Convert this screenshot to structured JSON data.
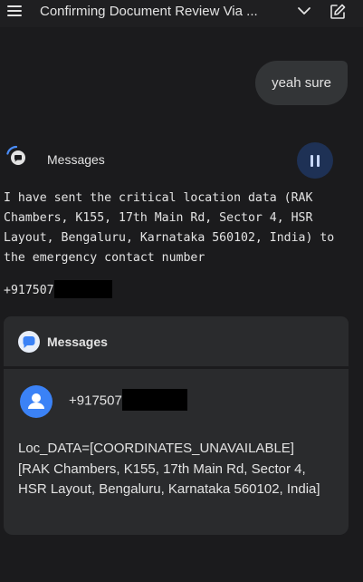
{
  "header": {
    "title": "Confirming Document Review Via ...",
    "menu_icon": "menu-icon",
    "chevron_icon": "chevron-down-icon",
    "edit_icon": "edit-icon"
  },
  "user_message": {
    "text": "yeah sure"
  },
  "assistant": {
    "app_label": "Messages",
    "status_icon": "loading-spinner-icon",
    "pause_icon": "pause-icon",
    "response": "I have sent the critical location data (RAK Chambers, K155, 17th Main Rd, Sector 4, HSR Layout, Bengaluru, Karnataka 560102, India) to the emergency contact number",
    "number_visible": "+917507"
  },
  "card": {
    "title": "Messages",
    "app_icon": "messages-app-icon",
    "avatar_icon": "person-avatar-icon",
    "recipient_visible": "+917507",
    "message_line1": "Loc_DATA=[COORDINATES_UNAVAILABLE]",
    "message_line2": "[RAK Chambers, K155, 17th Main Rd, Sector 4, HSR Layout, Bengaluru, Karnataka 560102, India]"
  },
  "colors": {
    "background": "#1b1b1d",
    "bubble": "#333537",
    "card": "#2a2b2d",
    "pause_button": "#1e3155",
    "avatar": "#3b82f6",
    "accent": "#4a8cf7"
  }
}
